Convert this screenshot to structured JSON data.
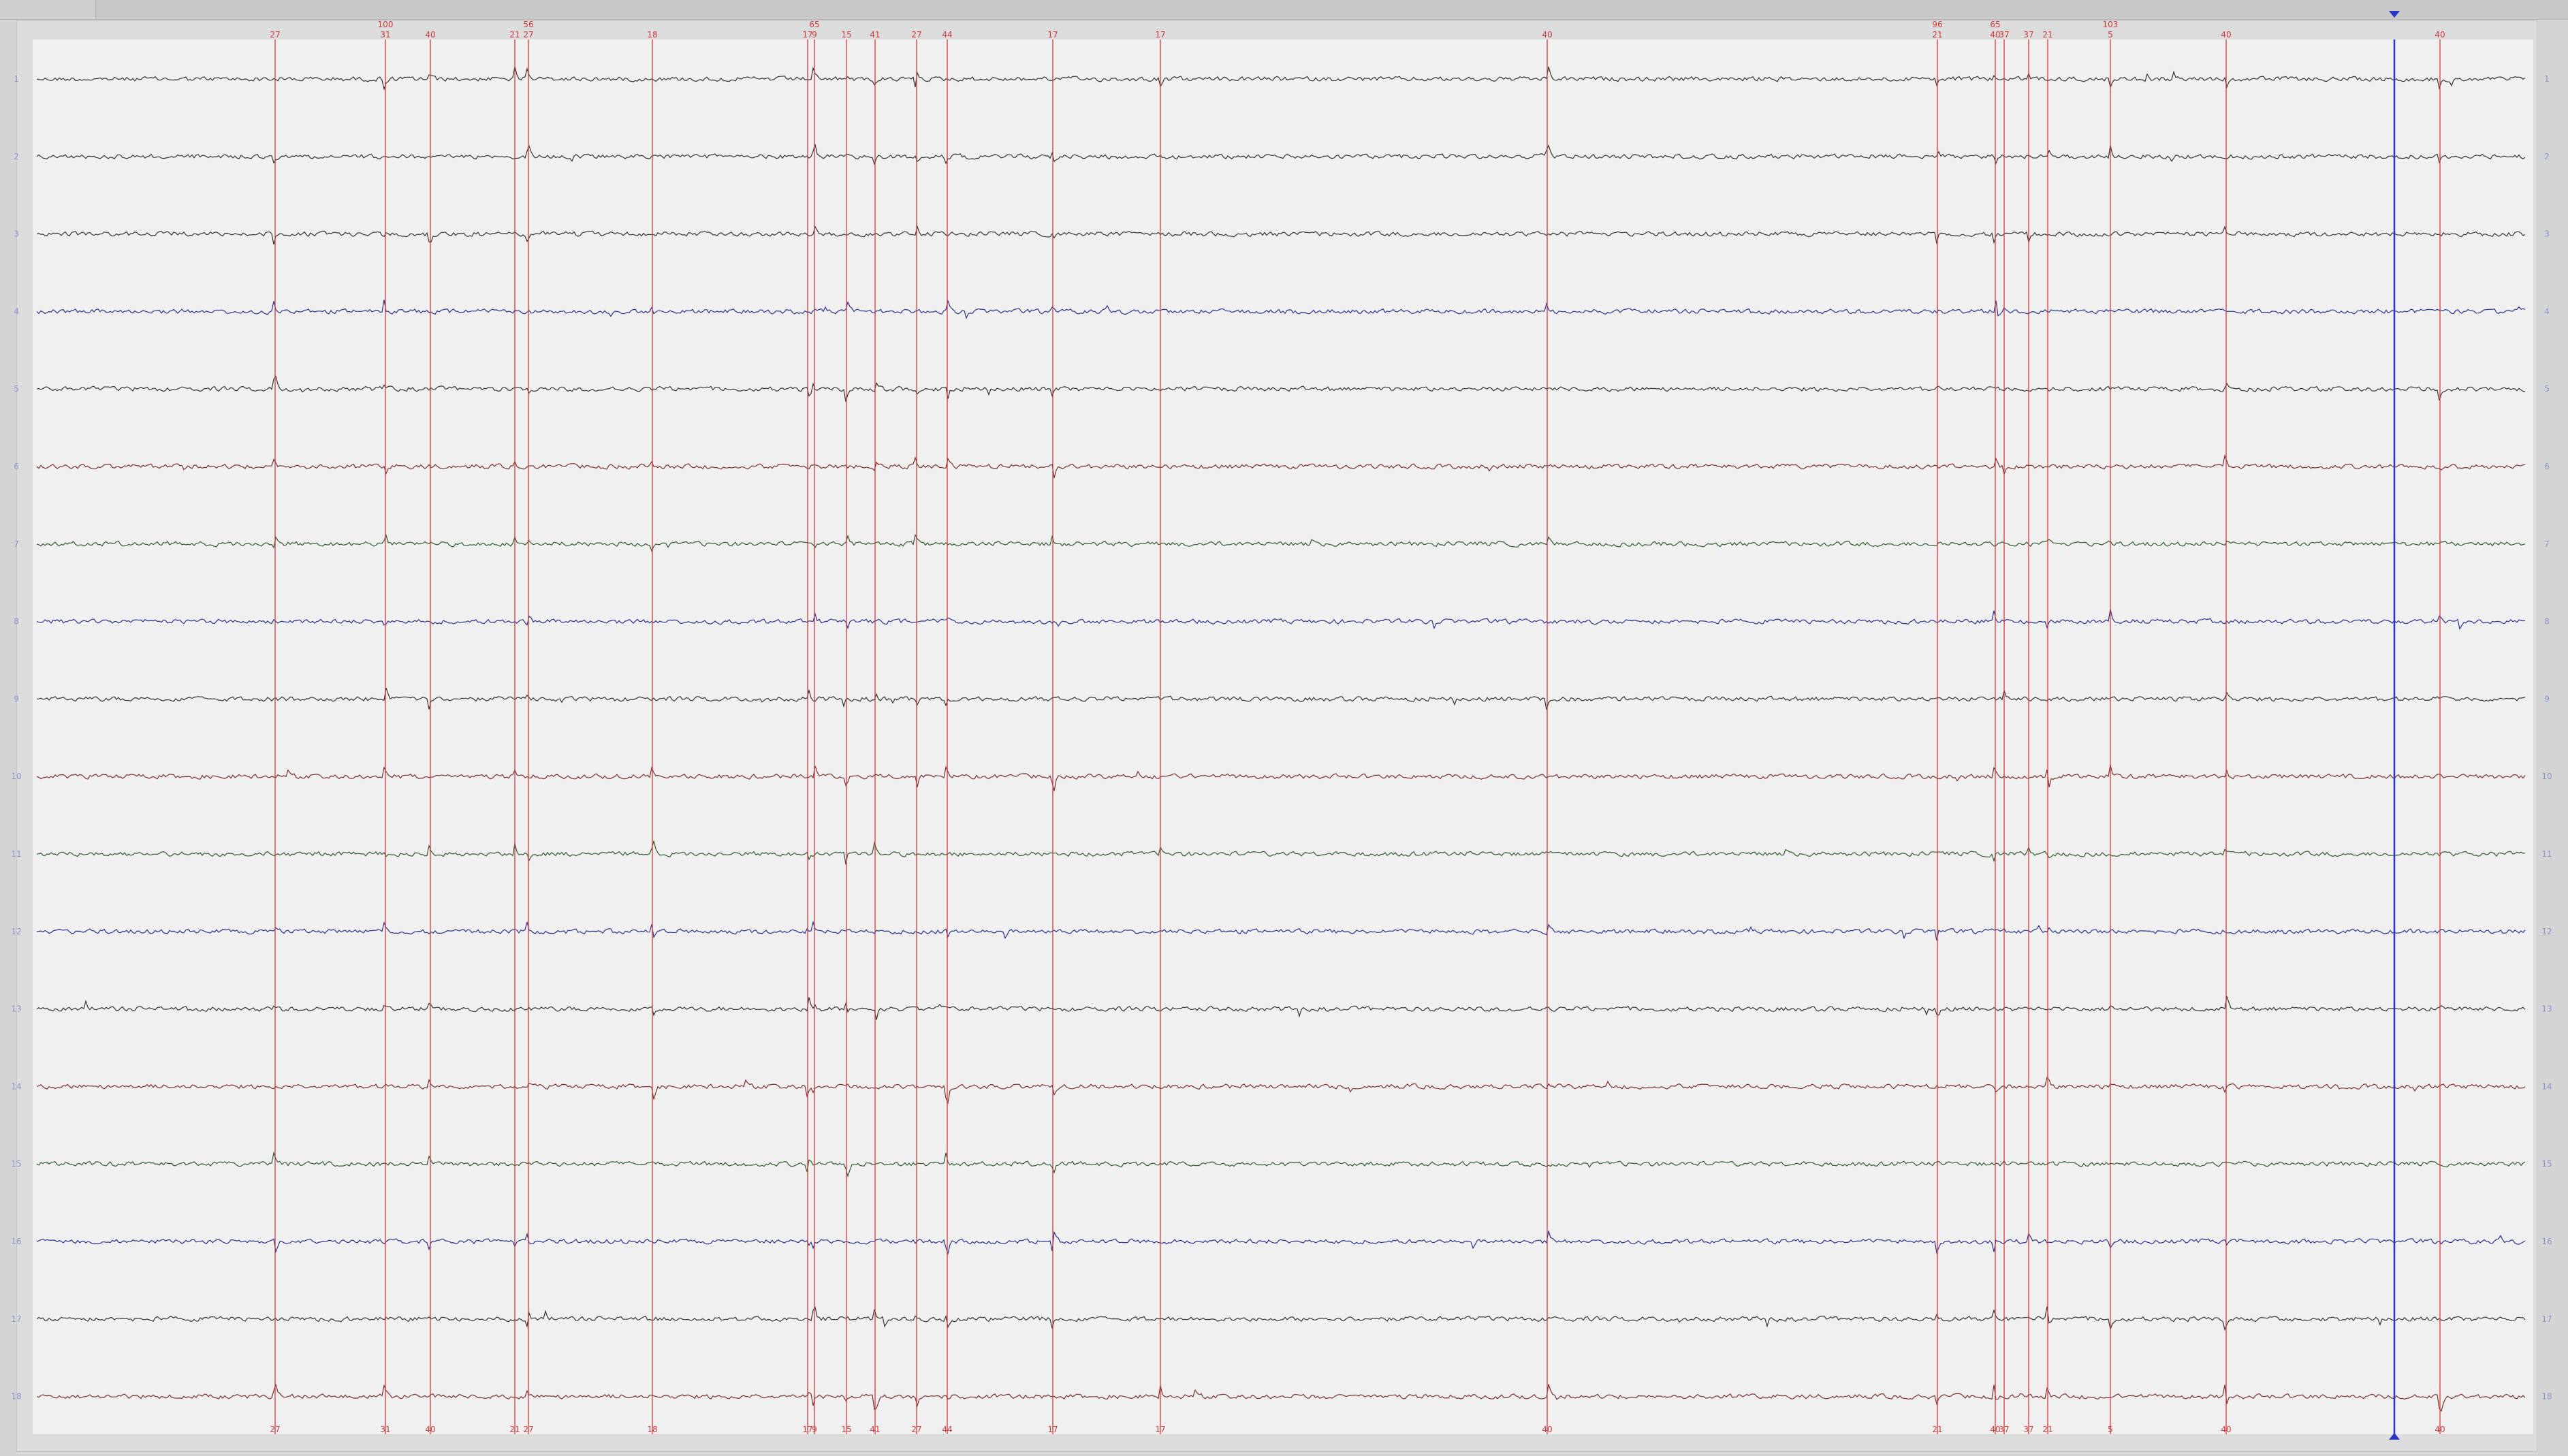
{
  "colors": {
    "background": "#f0f0f0",
    "marker_line": "#d23a3a",
    "cursor_line": "#2b35c8",
    "channel_label": "#8a96cc",
    "trace_black": "#333333",
    "trace_red": "#7a2e2e",
    "trace_blue": "#2a2f8a",
    "trace_green": "#2f5a2f"
  },
  "channels": [
    {
      "label": "1",
      "color": "trace_black"
    },
    {
      "label": "2",
      "color": "trace_black"
    },
    {
      "label": "3",
      "color": "trace_black"
    },
    {
      "label": "4",
      "color": "trace_blue"
    },
    {
      "label": "5",
      "color": "trace_black"
    },
    {
      "label": "6",
      "color": "trace_red"
    },
    {
      "label": "7",
      "color": "trace_green"
    },
    {
      "label": "8",
      "color": "trace_blue"
    },
    {
      "label": "9",
      "color": "trace_black"
    },
    {
      "label": "10",
      "color": "trace_red"
    },
    {
      "label": "11",
      "color": "trace_green"
    },
    {
      "label": "12",
      "color": "trace_blue"
    },
    {
      "label": "13",
      "color": "trace_black"
    },
    {
      "label": "14",
      "color": "trace_red"
    },
    {
      "label": "15",
      "color": "trace_green"
    },
    {
      "label": "16",
      "color": "trace_blue"
    },
    {
      "label": "17",
      "color": "trace_black"
    },
    {
      "label": "18",
      "color": "trace_red"
    }
  ],
  "markers": [
    {
      "label": "27"
    },
    {
      "label": "31",
      "extra": "100"
    },
    {
      "label": "40"
    },
    {
      "label": "21"
    },
    {
      "label": "27",
      "extra": "56"
    },
    {
      "label": "18"
    },
    {
      "label": "17"
    },
    {
      "label": "9",
      "extra": "65"
    },
    {
      "label": "15"
    },
    {
      "label": "41"
    },
    {
      "label": "27"
    },
    {
      "label": "44"
    },
    {
      "label": "17"
    },
    {
      "label": "17"
    },
    {
      "label": "40"
    },
    {
      "label": "21",
      "extra": "96"
    },
    {
      "label": "40",
      "extra": "65"
    },
    {
      "label": "37"
    },
    {
      "label": "37"
    },
    {
      "label": "21"
    },
    {
      "label": "5",
      "extra": "103"
    },
    {
      "label": "40"
    },
    {
      "label": "40"
    }
  ],
  "cursor": {
    "present": true
  }
}
